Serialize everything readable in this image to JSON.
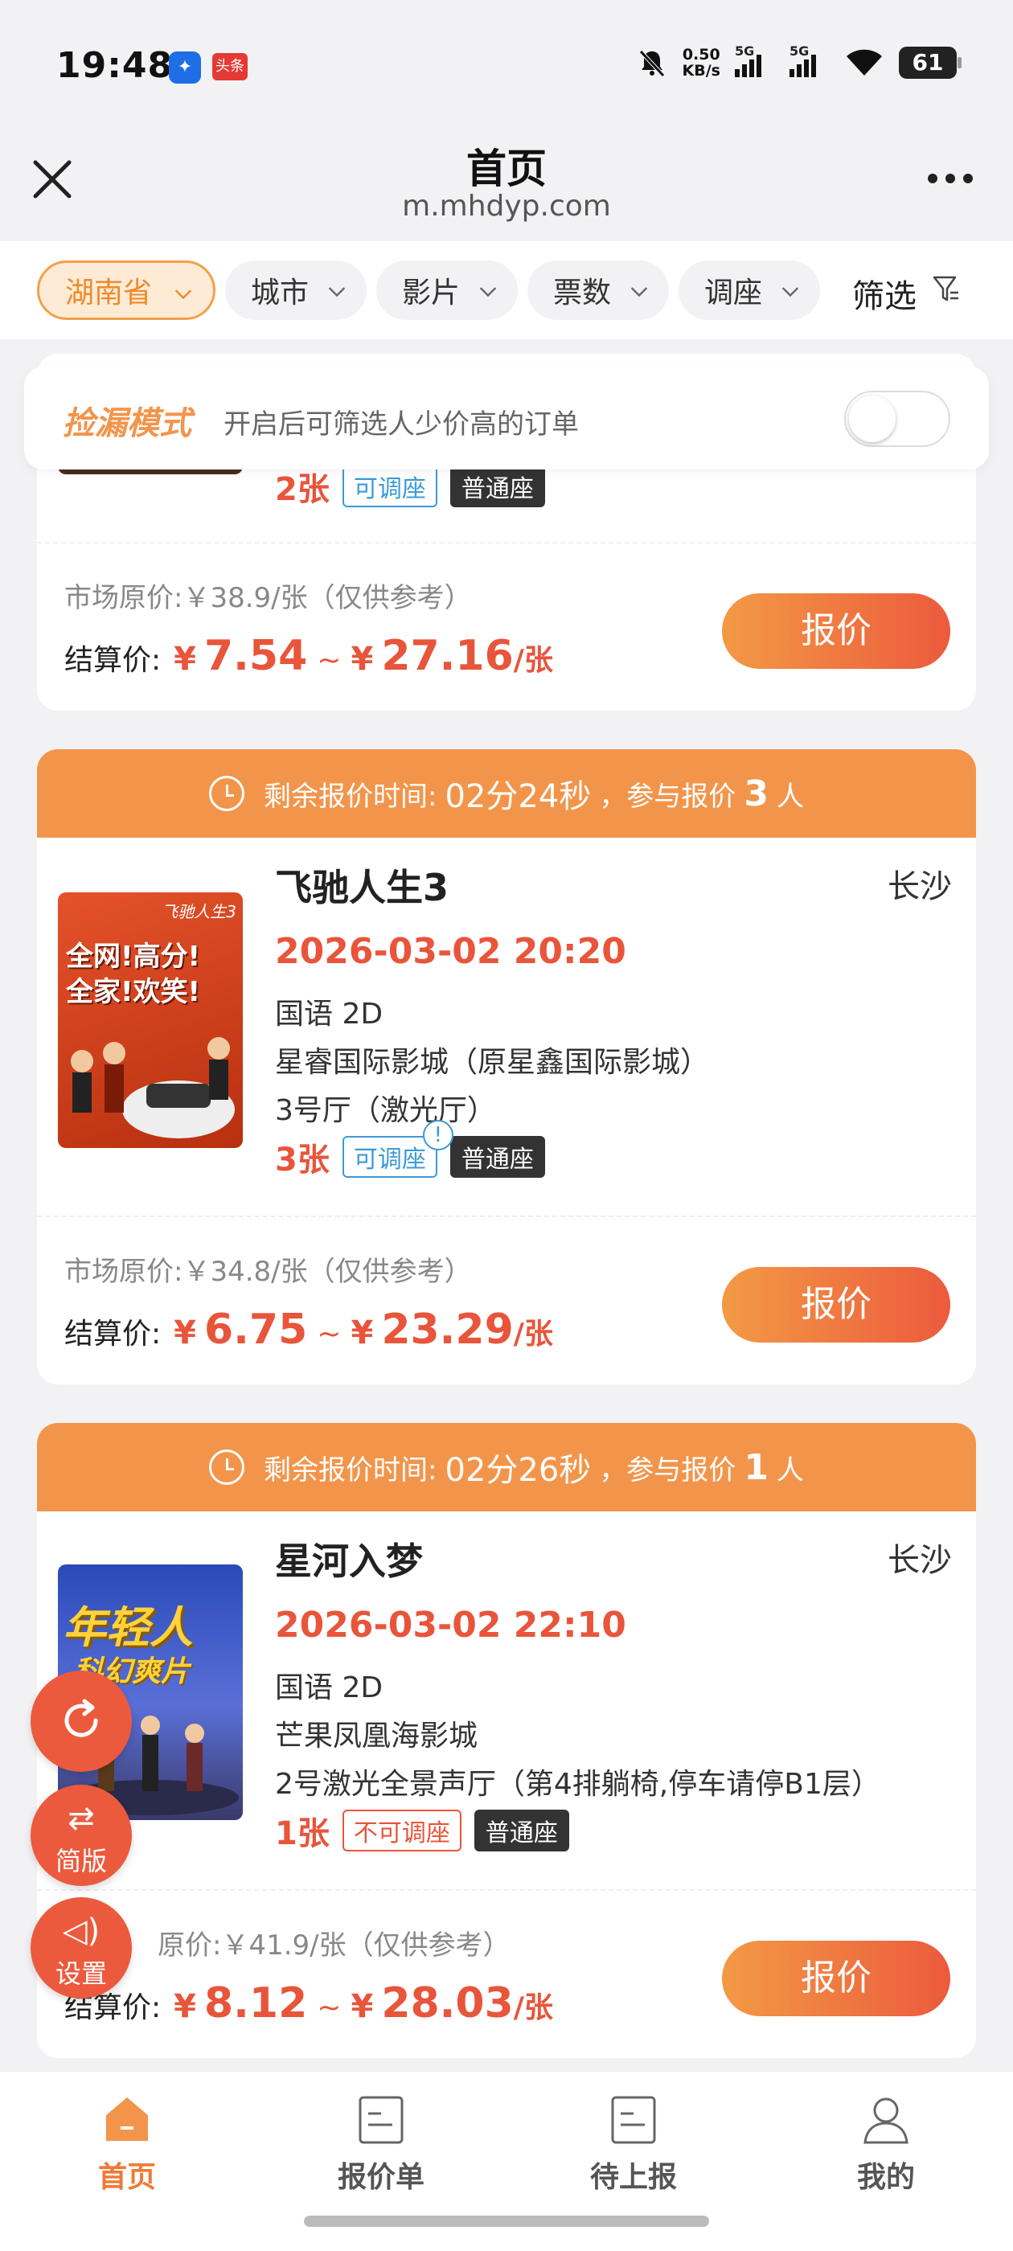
{
  "status_bar": {
    "time": "19:48",
    "app_badge_2": "头条",
    "net_speed_value": "0.50",
    "net_speed_unit": "KB/s",
    "signal_1": "5G",
    "signal_2": "5G",
    "battery": "61"
  },
  "titlebar": {
    "title": "首页",
    "url": "m.mhdyp.com"
  },
  "filters": {
    "province": "湖南省",
    "city": "城市",
    "movie": "影片",
    "tickets": "票数",
    "seat_adjust": "调座",
    "filter": "筛选"
  },
  "bargain_mode": {
    "title": "捡漏模式",
    "desc": "开启后可筛选人少价高的订单",
    "enabled": false
  },
  "partial_card": {
    "tickets": "2张",
    "adjust_tag": "可调座",
    "seat_type": "普通座",
    "market_price": "市场原价:￥38.9/张（仅供参考）",
    "settle_label": "结算价:",
    "price_min": "7.54",
    "price_max": "27.16",
    "yen": "¥",
    "tilde": "~",
    "unit": "/张",
    "quote_button": "报价"
  },
  "cards": [
    {
      "countdown_label": "剩余报价时间:",
      "countdown": "02分24秒",
      "participants_label": "，参与报价",
      "participants": "3",
      "participants_unit": "人",
      "movie": "飞驰人生3",
      "city": "长沙",
      "showtime": "2026-03-02 20:20",
      "format": "国语 2D",
      "cinema": "星睿国际影城（原星鑫国际影城）",
      "hall": "3号厅（激光厅）",
      "tickets": "3张",
      "adjust_tag": "可调座",
      "seat_type": "普通座",
      "market_price": "市场原价:￥34.8/张（仅供参考）",
      "settle_label": "结算价:",
      "yen": "¥",
      "price_min": "6.75",
      "tilde": "~",
      "price_max": "23.29",
      "unit": "/张",
      "quote_button": "报价",
      "poster_text_1": "全网!高分!",
      "poster_text_2": "全家!欢笑!",
      "poster_corner": "飞驰人生3"
    },
    {
      "countdown_label": "剩余报价时间:",
      "countdown": "02分26秒",
      "participants_label": "，参与报价",
      "participants": "1",
      "participants_unit": "人",
      "movie": "星河入梦",
      "city": "长沙",
      "showtime": "2026-03-02 22:10",
      "format": "国语 2D",
      "cinema": "芒果凤凰海影城",
      "hall": "2号激光全景声厅（第4排躺椅,停车请停B1层）",
      "tickets": "1张",
      "adjust_tag": "不可调座",
      "seat_type": "普通座",
      "market_price": "原价:￥41.9/张（仅供参考）",
      "settle_label": "结算价:",
      "yen": "¥",
      "price_min": "8.12",
      "tilde": "~",
      "price_max": "28.03",
      "unit": "/张",
      "quote_button": "报价",
      "poster_text_1": "年轻人",
      "poster_text_2": "科幻爽片"
    }
  ],
  "floating": {
    "refresh_icon": "refresh-icon",
    "simple_label": "简版",
    "settings_label": "设置"
  },
  "bottom_nav": [
    {
      "label": "首页",
      "active": true
    },
    {
      "label": "报价单",
      "active": false
    },
    {
      "label": "待上报",
      "active": false
    },
    {
      "label": "我的",
      "active": false
    }
  ],
  "colors": {
    "accent": "#f2954b",
    "price_red": "#e8553b",
    "button_gradient_start": "#f39a45",
    "button_gradient_end": "#ec5a3d"
  }
}
